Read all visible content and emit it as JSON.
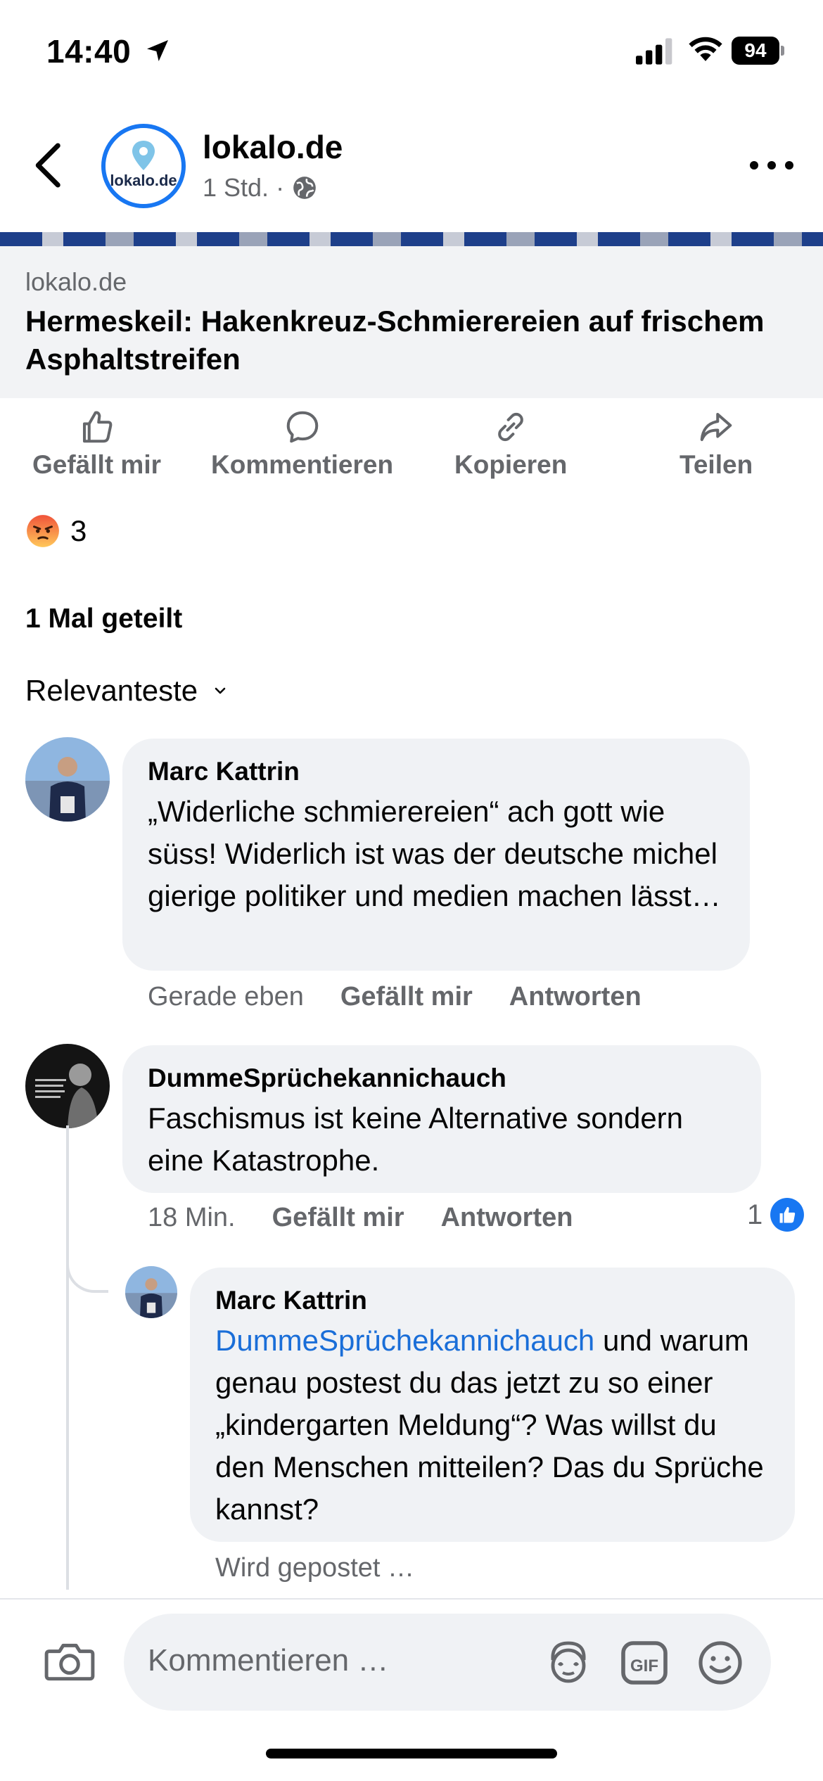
{
  "status_bar": {
    "time": "14:40",
    "battery": "94"
  },
  "header": {
    "page_name": "lokalo.de",
    "logo_text": "lokalo.de",
    "meta": "1 Std. ·"
  },
  "link_preview": {
    "domain": "lokalo.de",
    "title": "Hermeskeil: Hakenkreuz-Schmierereien auf frischem Asphaltstreifen"
  },
  "actions": {
    "like": "Gefällt mir",
    "comment": "Kommentieren",
    "copy": "Kopieren",
    "share": "Teilen"
  },
  "reactions": {
    "count": "3"
  },
  "shares": "1 Mal geteilt",
  "sort": {
    "label": "Relevanteste"
  },
  "comments": [
    {
      "author": "Marc Kattrin",
      "text": "„Widerliche schmierereien“ ach gott wie süss! Widerlich ist was der deutsche michel gierige politiker und medien machen lässt…",
      "time": "Gerade eben",
      "like": "Gefällt mir",
      "reply": "Antworten"
    },
    {
      "author": "DummeSprüchekannichauch",
      "text": "Faschismus ist keine Alternative sondern eine Katastrophe.",
      "time": "18 Min.",
      "like": "Gefällt mir",
      "reply": "Antworten",
      "like_count": "1",
      "replies": [
        {
          "author": "Marc Kattrin",
          "mention": "DummeSprüchekannichauch",
          "text": " und warum genau postest du das jetzt zu so einer „kindergarten Meldung“? Was willst du den Menschen mitteilen? Das du Sprüche kannst?",
          "status": "Wird gepostet …"
        }
      ]
    }
  ],
  "composer": {
    "placeholder": "Kommentieren …",
    "gif": "GIF"
  },
  "colors": {
    "accent": "#1877f2",
    "mention": "#1a6ed8",
    "bubble": "#f0f2f5",
    "secondary_text": "#65676b"
  }
}
